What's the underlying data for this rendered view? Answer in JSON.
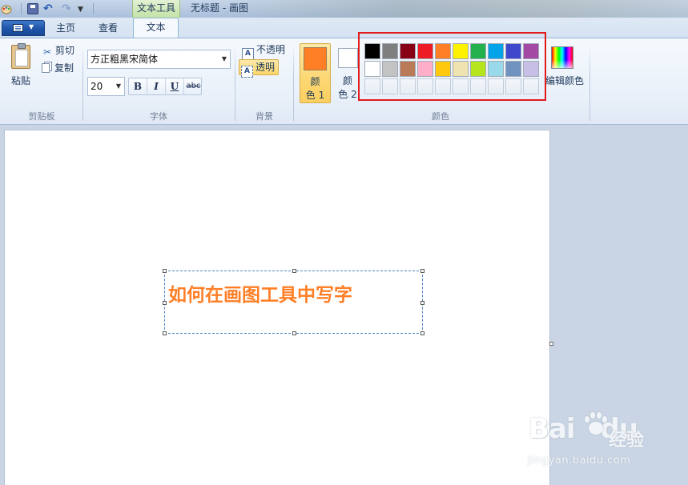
{
  "title_bar": {
    "context_tab_header": "文本工具",
    "window_title": "无标题 - 画图"
  },
  "tabs": [
    {
      "label": "主页"
    },
    {
      "label": "查看"
    },
    {
      "label": "文本"
    }
  ],
  "active_tab": "文本",
  "ribbon": {
    "clipboard": {
      "paste_label": "粘贴",
      "cut_label": "剪切",
      "copy_label": "复制",
      "group_label": "剪贴板"
    },
    "font": {
      "font_name": "方正粗黑宋简体",
      "font_size": "20",
      "bold": "B",
      "italic": "I",
      "underline": "U",
      "strikethrough": "abc",
      "group_label": "字体"
    },
    "background": {
      "opaque_label": "不透明",
      "transparent_label": "透明",
      "selected": "透明",
      "group_label": "背景"
    },
    "colors": {
      "color1_line1": "颜",
      "color1_line2": "色 1",
      "color1_value": "#ff7f27",
      "color2_line1": "颜",
      "color2_line2": "色 2",
      "color2_value": "#ffffff",
      "edit_colors_label": "编辑颜色",
      "group_label": "颜色",
      "palette_rows": [
        [
          "#000000",
          "#7f7f7f",
          "#880015",
          "#ed1c24",
          "#ff7f27",
          "#fff200",
          "#22b14c",
          "#00a2e8",
          "#3f48cc",
          "#a349a4"
        ],
        [
          "#ffffff",
          "#c3c3c3",
          "#b97a57",
          "#ffaec9",
          "#ffc90e",
          "#efe4b0",
          "#b5e61d",
          "#99d9ea",
          "#7092be",
          "#c8bfe7"
        ],
        [
          "",
          "",
          "",
          "",
          "",
          "",
          "",
          "",
          "",
          ""
        ]
      ]
    }
  },
  "canvas": {
    "text_content": "如何在画图工具中写字",
    "text_color": "#ff7f27"
  },
  "watermark": {
    "logo": "Bai",
    "logo_tail": "du",
    "cn": "经验",
    "url": "jingyan.baidu.com"
  },
  "annotation_color": "#e01b1b"
}
